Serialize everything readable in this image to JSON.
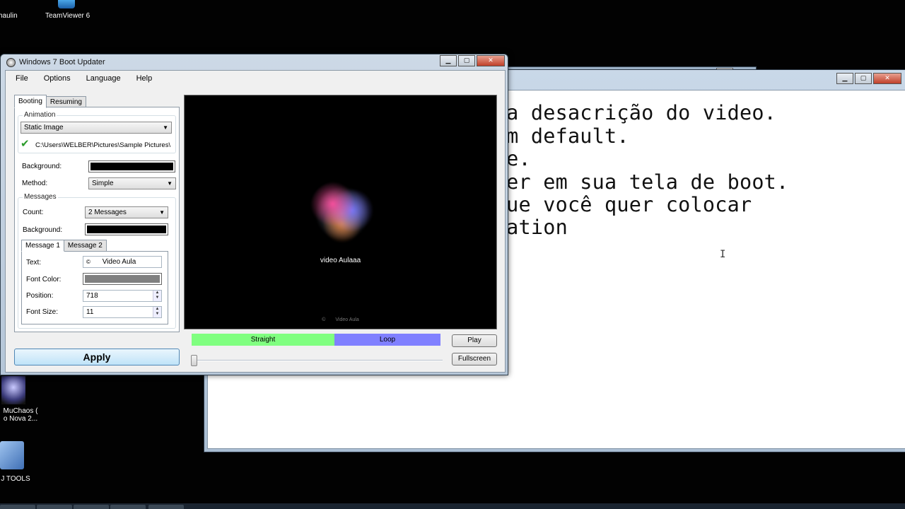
{
  "desktop": {
    "icons": [
      {
        "label": "haulin"
      },
      {
        "label": "TeamViewer 6"
      },
      {
        "label_line1": "MuChaos (",
        "label_line2": "o Nova 2..."
      },
      {
        "label": "J TOOLS"
      }
    ]
  },
  "notepad": {
    "lines": [
      "está na desacrição do video.",
      "ique em default.",
      "m image.",
      "ocê quer em sua tela de boot.",
      "lha oque você quer colocar",
      "corparation"
    ]
  },
  "app": {
    "title": "Windows 7 Boot Updater",
    "menu": [
      "File",
      "Options",
      "Language",
      "Help"
    ],
    "tabs": [
      "Booting",
      "Resuming"
    ],
    "animation": {
      "group_title": "Animation",
      "type_value": "Static Image",
      "path": "C:\\Users\\WELBER\\Pictures\\Sample Pictures\\"
    },
    "background_label": "Background:",
    "background_color": "#000000",
    "method_label": "Method:",
    "method_value": "Simple",
    "messages": {
      "group_title": "Messages",
      "count_label": "Count:",
      "count_value": "2 Messages",
      "background_label": "Background:",
      "background_color": "#000000",
      "tabs": [
        "Message 1",
        "Message 2"
      ],
      "text_label": "Text:",
      "text_value": "Video Aula",
      "text_symbol": "©",
      "font_color_label": "Font Color:",
      "font_color": "#808080",
      "position_label": "Position:",
      "position_value": "718",
      "font_size_label": "Font Size:",
      "font_size_value": "11"
    },
    "apply_label": "Apply",
    "preview": {
      "caption": "video Aulaaa",
      "footer_symbol": "©",
      "footer_text": "Video Aula"
    },
    "straight_label": "Straight",
    "loop_label": "Loop",
    "straight_color": "#80ff80",
    "loop_color": "#8080ff",
    "play_label": "Play",
    "fullscreen_label": "Fullscreen"
  }
}
